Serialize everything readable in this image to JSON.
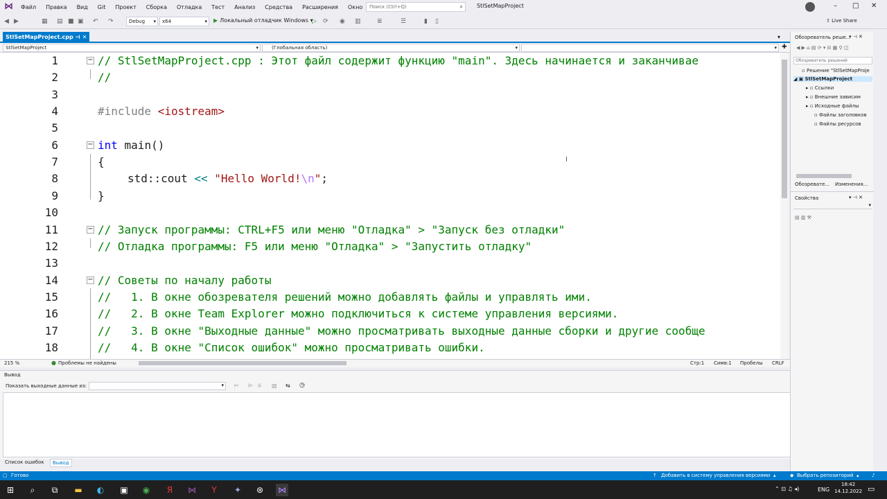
{
  "menu": {
    "items": [
      "Файл",
      "Правка",
      "Вид",
      "Git",
      "Проект",
      "Сборка",
      "Отладка",
      "Тест",
      "Анализ",
      "Средства",
      "Расширения",
      "Окно",
      "Справка"
    ],
    "search_placeholder": "Поиск (Ctrl+Q)",
    "project_title": "StlSetMapProject"
  },
  "toolbar": {
    "config": "Debug",
    "platform": "x64",
    "run_label": "Локальный отладчик Windows",
    "live_share": "Live Share"
  },
  "doc": {
    "tab_name": "StlSetMapProject.cpp",
    "nav_project": "StlSetMapProject",
    "nav_scope": "(Глобальная область)"
  },
  "editor": {
    "lines": [
      {
        "n": "1",
        "fold": "⊟",
        "text": "// StlSetMapProject.cpp : Этот файл содержит функцию \"main\". Здесь начинается и заканчивае"
      },
      {
        "n": "2",
        "fold": "",
        "text": "//"
      },
      {
        "n": "3",
        "fold": "",
        "text": ""
      },
      {
        "n": "4",
        "fold": "",
        "pp": "#include ",
        "inc": "<iostream>"
      },
      {
        "n": "5",
        "fold": "",
        "text": ""
      },
      {
        "n": "6",
        "fold": "⊟",
        "kw": "int",
        "rest": " main()"
      },
      {
        "n": "7",
        "fold": "",
        "plain": "{"
      },
      {
        "n": "8",
        "fold": "",
        "cout": true
      },
      {
        "n": "9",
        "fold": "",
        "plain": "}"
      },
      {
        "n": "10",
        "fold": "",
        "text": ""
      },
      {
        "n": "11",
        "fold": "⊟",
        "text": "// Запуск программы: CTRL+F5 или меню \"Отладка\" > \"Запуск без отладки\""
      },
      {
        "n": "12",
        "fold": "",
        "text": "// Отладка программы: F5 или меню \"Отладка\" > \"Запустить отладку\""
      },
      {
        "n": "13",
        "fold": "",
        "text": ""
      },
      {
        "n": "14",
        "fold": "⊟",
        "text": "// Советы по началу работы"
      },
      {
        "n": "15",
        "fold": "",
        "text": "//   1. В окне обозревателя решений можно добавлять файлы и управлять ими."
      },
      {
        "n": "16",
        "fold": "",
        "text": "//   2. В окне Team Explorer можно подключиться к системе управления версиями."
      },
      {
        "n": "17",
        "fold": "",
        "text": "//   3. В окне \"Выходные данные\" можно просматривать выходные данные сборки и другие сообще"
      },
      {
        "n": "18",
        "fold": "",
        "text": "//   4. В окне \"Список ошибок\" можно просматривать ошибки."
      }
    ],
    "cout_std": "std::cout ",
    "cout_op": "<<",
    "cout_str1": " \"Hello World!",
    "cout_esc": "\\n",
    "cout_str2": "\"",
    "cout_end": ";"
  },
  "editor_status": {
    "zoom": "215 %",
    "problems": "Проблемы не найдены",
    "line": "Стр:1",
    "col": "Симв:1",
    "spaces": "Пробелы",
    "eol": "CRLF"
  },
  "output": {
    "title": "Вывод",
    "show_from": "Показать выходные данные из:"
  },
  "bottom_tabs": [
    "Список ошибок",
    "Вывод"
  ],
  "status": {
    "ready": "Готово",
    "add_vcs": "Добавить в систему управления версиями",
    "select_repo": "Выбрать репозиторий"
  },
  "solution": {
    "title": "Обозреватель реше...",
    "search": "Обозреватель решений",
    "items": [
      "Решение \"StlSetMapProje",
      "StlSetMapProject",
      "Ссылки",
      "Внешние зависим",
      "Исходные файлы",
      "Файлы заголовков",
      "Файлы ресурсов"
    ],
    "tab1": "Обозревате...",
    "tab2": "Изменения..."
  },
  "properties": {
    "title": "Свойства"
  },
  "taskbar": {
    "lang": "ENG",
    "time": "18:42",
    "date": "14.12.2022"
  },
  "colors": {
    "accent": "#007acc",
    "comment": "#008000",
    "keyword": "#0000ff",
    "string": "#a31515"
  }
}
